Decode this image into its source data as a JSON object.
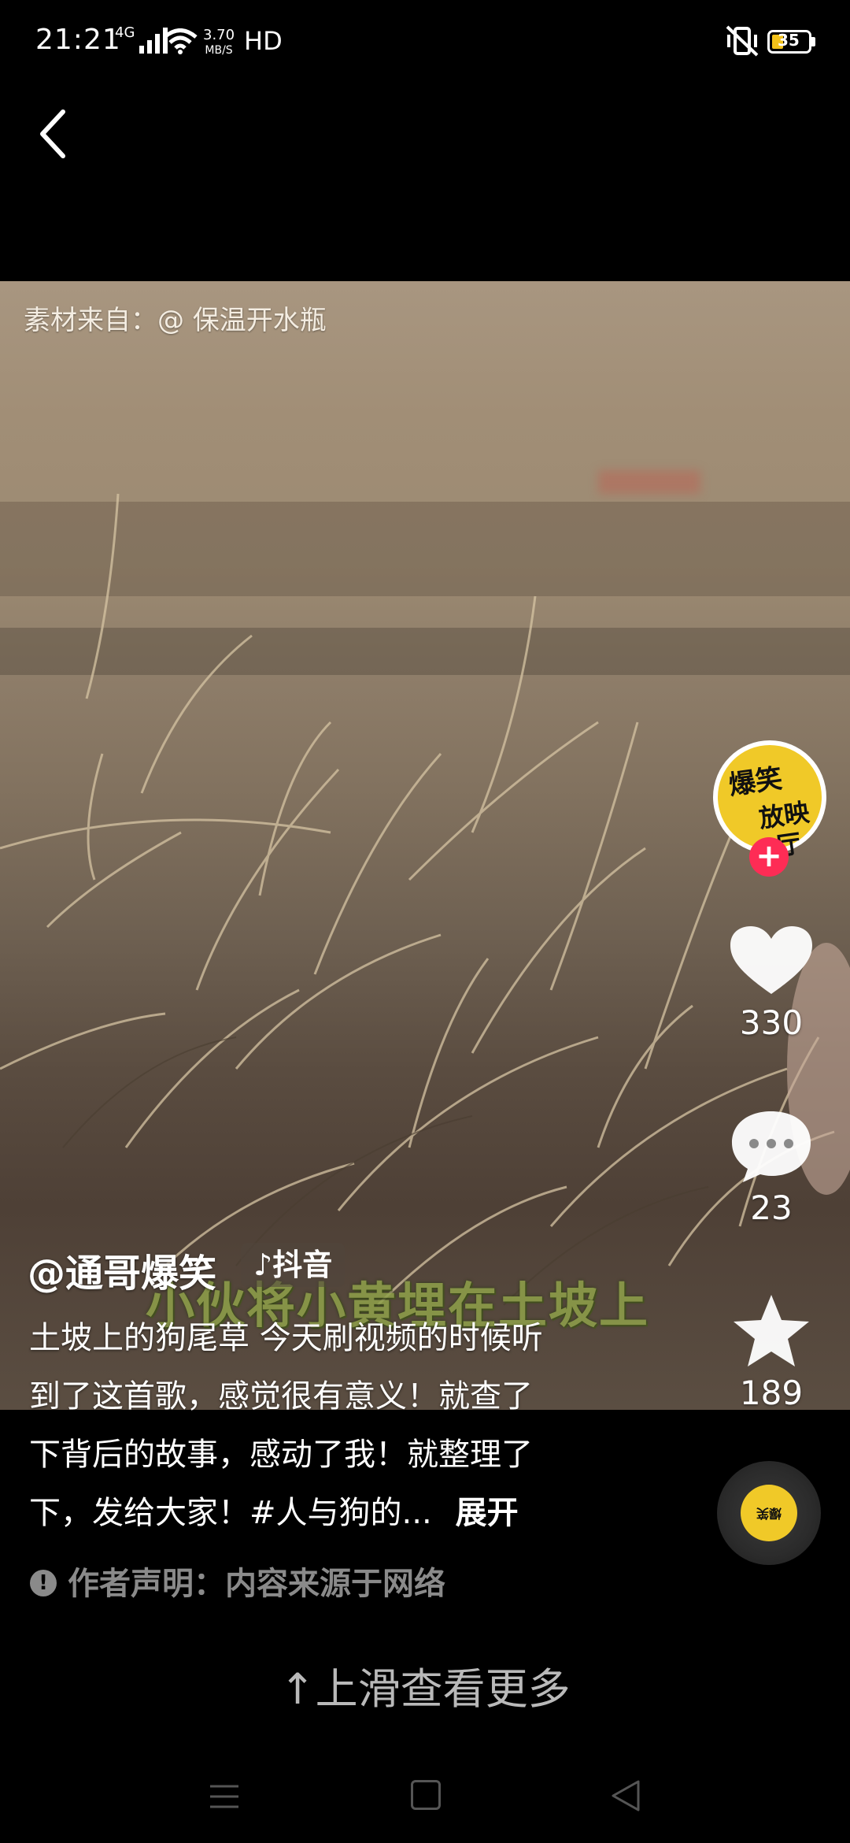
{
  "status_bar": {
    "time": "21:21",
    "network": "4G",
    "speed_value": "3.70",
    "speed_unit": "MB/S",
    "hd": "HD",
    "battery": "35"
  },
  "video": {
    "source_credit": "素材来自：@ 保温开水瓶",
    "subtitle": "小伙将小黄埋在土坡上"
  },
  "author": {
    "avatar_text_line1": "爆笑",
    "avatar_text_line2": "放映厅",
    "username": "@通哥爆笑",
    "platform_tag": "♪抖音"
  },
  "actions": {
    "follow": "+",
    "likes": "330",
    "comments": "23",
    "favorites": "189"
  },
  "description": {
    "line1": "土坡上的狗尾草 今天刷视频的时候听",
    "line2": "到了这首歌，感觉很有意义！就查了",
    "line3": "下背后的故事，感动了我！就整理了",
    "line4": "下，发给大家！#人与狗的...",
    "expand": "展开"
  },
  "declaration": {
    "icon": "!",
    "text": "作者声明：内容来源于网络"
  },
  "swipe_hint": "↑上滑查看更多",
  "colors": {
    "follow_red": "#fe2c55",
    "avatar_yellow": "#f0c928"
  }
}
